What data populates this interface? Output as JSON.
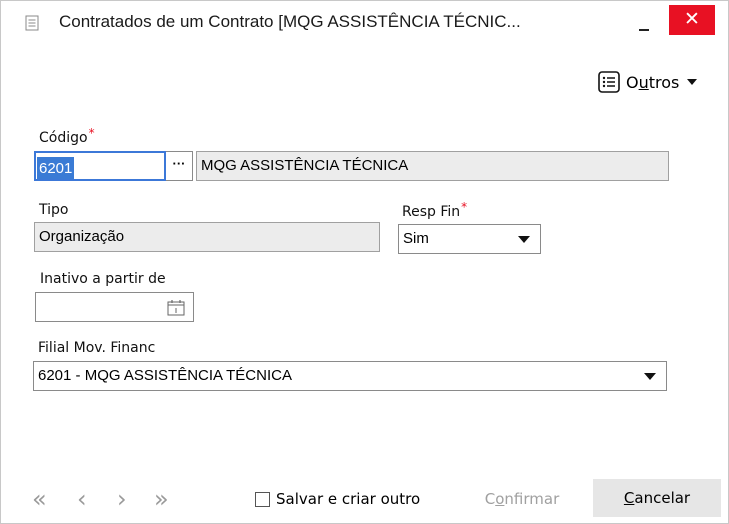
{
  "window": {
    "title": "Contratados de um Contrato [MQG ASSISTÊNCIA TÉCNIC...",
    "minimize": "–",
    "close": "✕",
    "close_color": "#e81123"
  },
  "toolbar": {
    "outros_pre": "O",
    "outros_ul": "u",
    "outros_post": "tros"
  },
  "form": {
    "codigo_label": "Código",
    "required_mark": "*",
    "codigo_value": "6201",
    "lookup_button": "···",
    "codigo_description": "MQG ASSISTÊNCIA TÉCNICA",
    "tipo_label": "Tipo",
    "tipo_value": "Organização",
    "resp_fin_label": "Resp Fin",
    "resp_fin_value": "Sim",
    "inativo_label": "Inativo a partir de",
    "inativo_value": "",
    "filial_label": "Filial Mov. Financ",
    "filial_value": "6201 - MQG ASSISTÊNCIA TÉCNICA"
  },
  "footer": {
    "first": "«",
    "prev": "‹",
    "next": "›",
    "last": "»",
    "save_new_label": "Salvar e criar outro",
    "confirm_pre": "C",
    "confirm_ul": "o",
    "confirm_post": "nfirmar",
    "cancel_ul": "C",
    "cancel_post": "ancelar"
  },
  "colors": {
    "accent": "#3a7bd5",
    "readonly_bg": "#ececec",
    "required": "#e81123"
  }
}
